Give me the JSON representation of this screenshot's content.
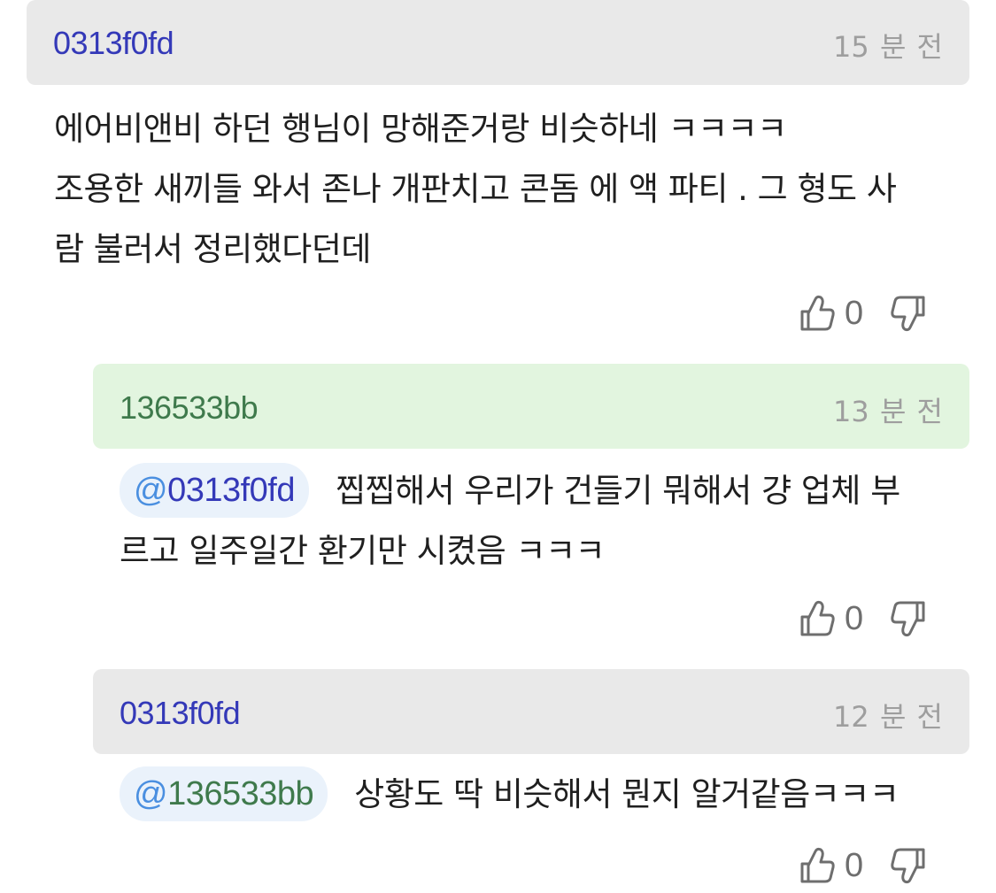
{
  "comments": [
    {
      "username": "0313f0fd",
      "time": "15 분 전",
      "body_lines": [
        "에어비앤비 하던 행님이 망해준거랑 비슷하네 ㅋㅋㅋㅋ",
        "조용한 새끼들 와서 존나 개판치고 콘돔 에 액 파티 . 그 형도 사",
        "람 불러서 정리했다던데"
      ],
      "likes": "0",
      "header_bg": "#e9e9e9",
      "username_color": "#3439b8"
    },
    {
      "username": "136533bb",
      "time": "13 분 전",
      "mention": "0313f0fd",
      "mention_color": "#3439b8",
      "body_lines": [
        "찝찝해서 우리가 건들기 뭐해서 걍 업체 부",
        "르고 일주일간 환기만 시켰음 ㅋㅋㅋ"
      ],
      "likes": "0",
      "header_bg": "#e2f5df",
      "username_color": "#3f7a4c"
    },
    {
      "username": "0313f0fd",
      "time": "12 분 전",
      "mention": "136533bb",
      "mention_color": "#3f7a4c",
      "body_lines": [
        "상황도 딱 비슷해서 뭔지 알거같음ㅋㅋㅋ"
      ],
      "likes": "0",
      "header_bg": "#e9e9e9",
      "username_color": "#3439b8"
    }
  ],
  "icons": {
    "like": "thumbs-up-outline-icon",
    "dislike": "thumbs-down-outline-icon"
  }
}
